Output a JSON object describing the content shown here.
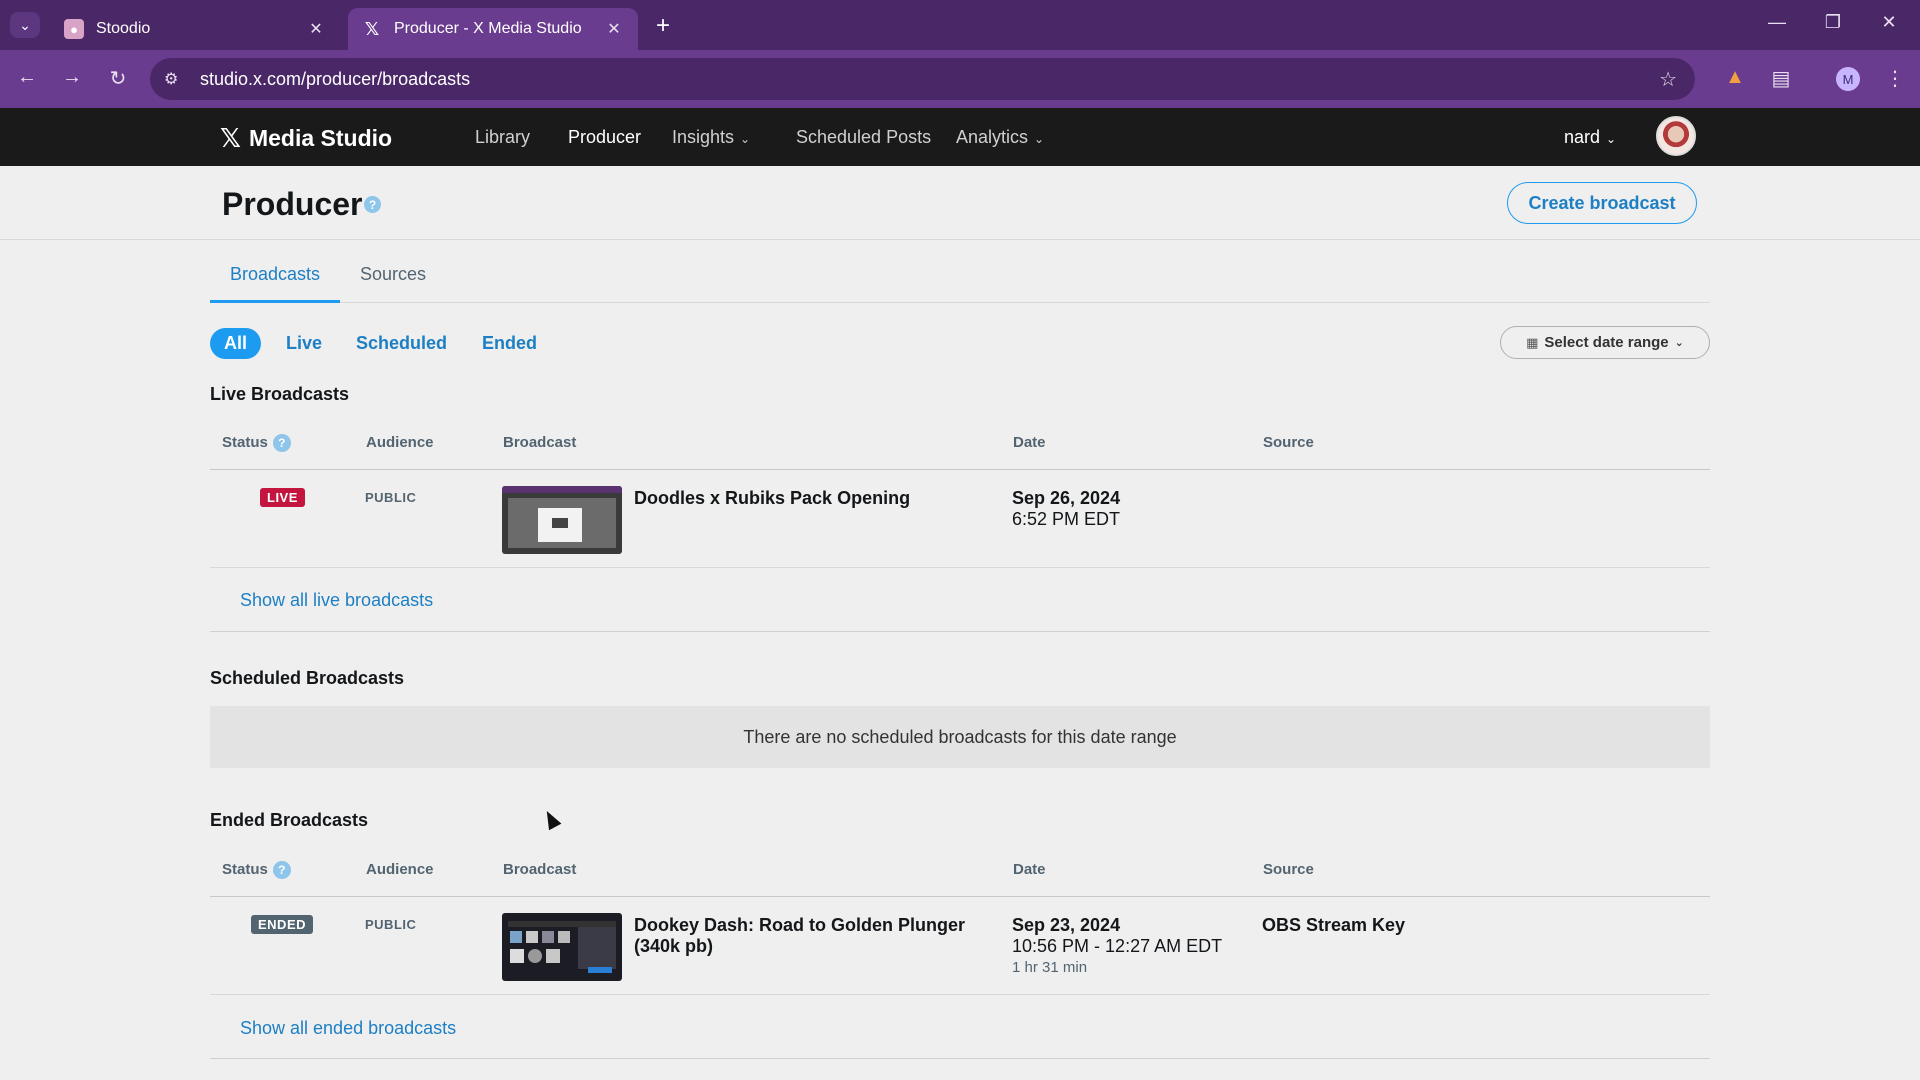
{
  "browser": {
    "tabs": [
      {
        "title": "Stoodio",
        "active": false,
        "favicon": "stoodio-icon"
      },
      {
        "title": "Producer - X Media Studio",
        "active": true,
        "favicon": "x-logo-icon"
      }
    ],
    "url": "studio.x.com/producer/broadcasts",
    "profile_initial": "M"
  },
  "app": {
    "brand": "Media Studio",
    "nav": [
      {
        "label": "Library"
      },
      {
        "label": "Producer"
      },
      {
        "label": "Insights"
      },
      {
        "label": "Scheduled Posts"
      },
      {
        "label": "Analytics"
      }
    ],
    "user": "nard"
  },
  "page": {
    "title": "Producer",
    "help_glyph": "?",
    "create_button": "Create broadcast",
    "tabs": [
      {
        "label": "Broadcasts",
        "active": true
      },
      {
        "label": "Sources",
        "active": false
      }
    ],
    "filters": [
      {
        "label": "All",
        "active": true
      },
      {
        "label": "Live"
      },
      {
        "label": "Scheduled"
      },
      {
        "label": "Ended"
      }
    ],
    "date_range": "Select date range"
  },
  "columns": {
    "status": "Status",
    "audience": "Audience",
    "broadcast": "Broadcast",
    "date": "Date",
    "source": "Source"
  },
  "live": {
    "title": "Live Broadcasts",
    "rows": [
      {
        "status": "LIVE",
        "audience": "PUBLIC",
        "title": "Doodles x Rubiks Pack Opening",
        "date": "Sep 26, 2024",
        "time": "6:52 PM EDT",
        "source": ""
      }
    ],
    "show_all": "Show all live broadcasts"
  },
  "scheduled": {
    "title": "Scheduled Broadcasts",
    "empty_message": "There are no scheduled broadcasts for this date range"
  },
  "ended": {
    "title": "Ended Broadcasts",
    "rows": [
      {
        "status": "ENDED",
        "audience": "PUBLIC",
        "title": "Dookey Dash: Road to Golden Plunger (340k pb)",
        "date": "Sep 23, 2024",
        "time": "10:56 PM - 12:27 AM EDT",
        "duration": "1 hr 31 min",
        "source": "OBS Stream Key"
      }
    ],
    "show_all": "Show all ended broadcasts"
  },
  "colors": {
    "accent": "#1d9bf0",
    "live_badge": "#c4153f",
    "ended_badge": "#536471",
    "browser_frame": "#4a2766"
  }
}
